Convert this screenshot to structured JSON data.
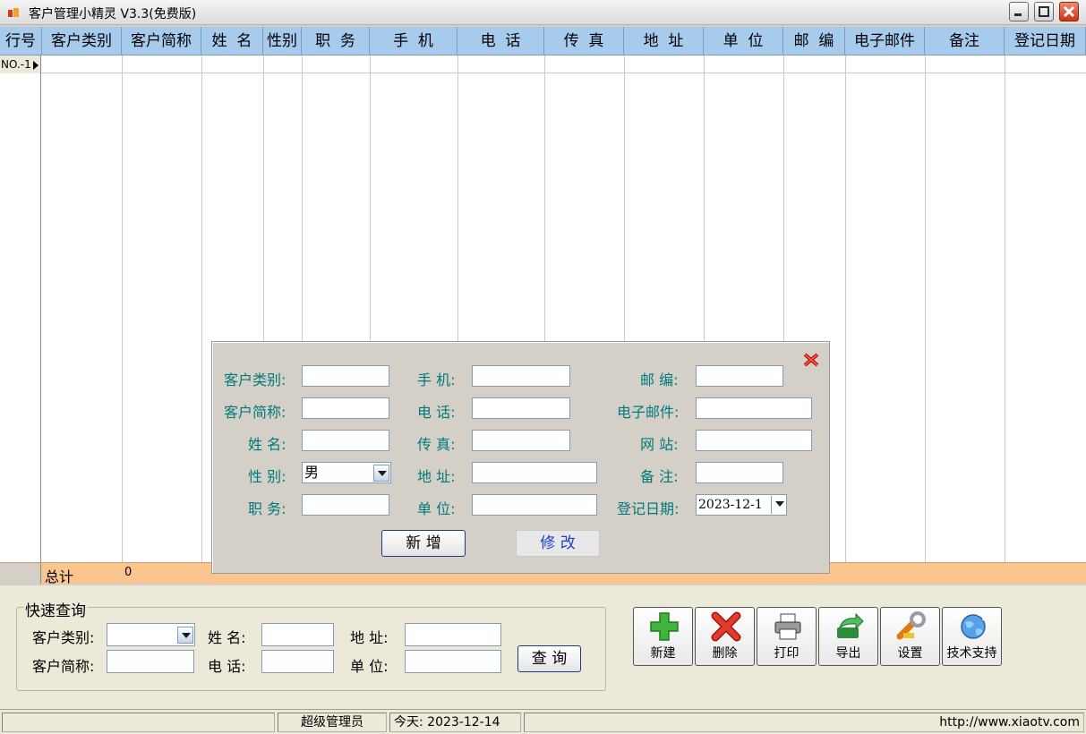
{
  "window": {
    "title": "客户管理小精灵 V3.3(免费版)"
  },
  "grid": {
    "columns": [
      "行号",
      "客户类别",
      "客户简称",
      "姓  名",
      "性别",
      "职  务",
      "手  机",
      "电  话",
      "传  真",
      "地  址",
      "单  位",
      "邮  编",
      "电子邮件",
      "备注",
      "登记日期"
    ],
    "row_label": "NO.-1",
    "total_label": "总计",
    "total_value": "0"
  },
  "form": {
    "category_label": "客户类别:",
    "short_name_label": "客户简称:",
    "name_label": "姓 名:",
    "gender_label": "性 别:",
    "gender_value": "男",
    "position_label": "职 务:",
    "mobile_label": "手 机:",
    "phone_label": "电 话:",
    "fax_label": "传 真:",
    "address_label": "地 址:",
    "company_label": "单 位:",
    "zip_label": "邮 编:",
    "email_label": "电子邮件:",
    "website_label": "网 站:",
    "remark_label": "备 注:",
    "date_label": "登记日期:",
    "date_value": "2023-12-1",
    "add_button": "新 增",
    "modify_button": "修 改"
  },
  "quick_search": {
    "title": "快速查询",
    "category_label": "客户类别:",
    "short_name_label": "客户简称:",
    "name_label": "姓 名:",
    "phone_label": "电 话:",
    "address_label": "地 址:",
    "company_label": "单 位:",
    "search_button": "查 询"
  },
  "toolbar": {
    "new_label": "新建",
    "delete_label": "删除",
    "print_label": "打印",
    "export_label": "导出",
    "settings_label": "设置",
    "support_label": "技术支持"
  },
  "status": {
    "user": "超级管理员",
    "today": "今天: 2023-12-14",
    "url": "http://www.xiaotv.com"
  },
  "colors": {
    "header_bg": "#a7cbed",
    "total_row_bg": "#fbc58f",
    "form_label": "#007a7a"
  },
  "icons": [
    "app-icon",
    "minimize-icon",
    "maximize-icon",
    "close-icon",
    "row-pointer-icon",
    "popup-close-icon",
    "dropdown-arrow-icon",
    "plus-icon",
    "delete-x-icon",
    "printer-icon",
    "export-arrow-icon",
    "wrench-icon",
    "globe-icon"
  ]
}
